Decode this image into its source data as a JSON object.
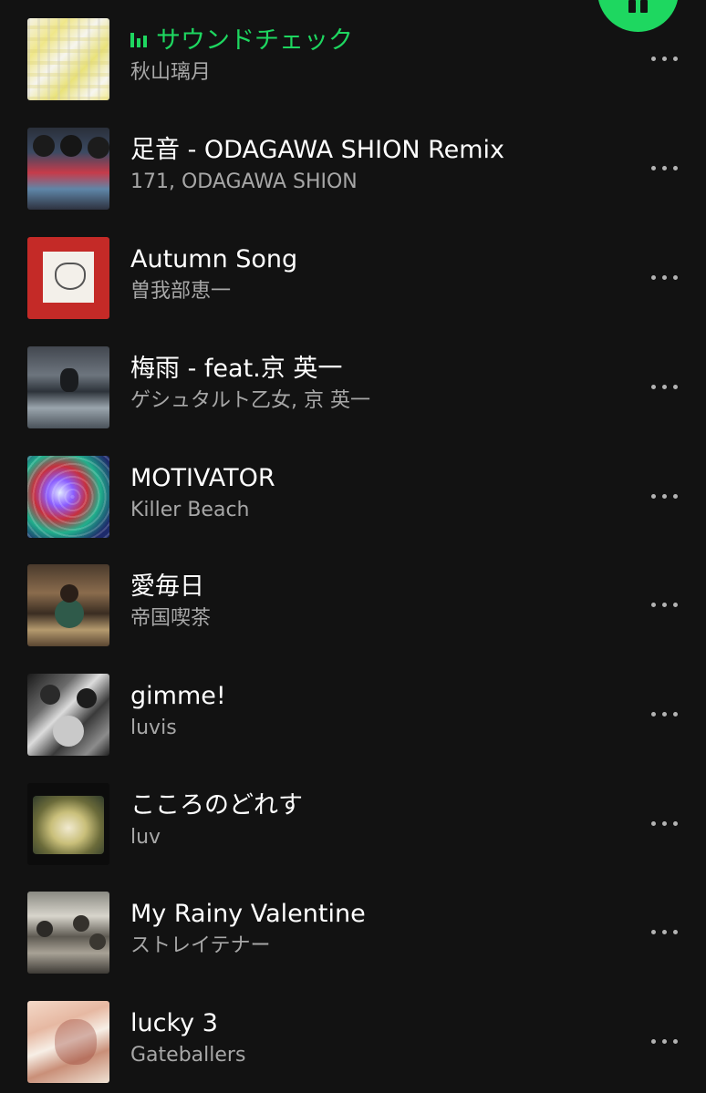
{
  "now_playing_button": {
    "icon": "pause-icon",
    "color": "#1ed760"
  },
  "tracks": [
    {
      "title": "サウンドチェック",
      "artist": "秋山璃月",
      "playing": true
    },
    {
      "title": "足音 - ODAGAWA SHION Remix",
      "artist": "171, ODAGAWA SHION",
      "playing": false
    },
    {
      "title": "Autumn Song",
      "artist": "曽我部恵一",
      "playing": false
    },
    {
      "title": "梅雨 - feat.京 英一",
      "artist": "ゲシュタルト乙女, 京 英一",
      "playing": false
    },
    {
      "title": "MOTIVATOR",
      "artist": "Killer Beach",
      "playing": false
    },
    {
      "title": "愛毎日",
      "artist": "帝国喫茶",
      "playing": false
    },
    {
      "title": "gimme!",
      "artist": "luvis",
      "playing": false
    },
    {
      "title": "こころのどれす",
      "artist": "luv",
      "playing": false
    },
    {
      "title": "My Rainy Valentine",
      "artist": "ストレイテナー",
      "playing": false
    },
    {
      "title": "lucky 3",
      "artist": "Gateballers",
      "playing": false
    }
  ],
  "row_more_icon": "more-horizontal-icon",
  "colors": {
    "background": "#121212",
    "accent": "#1ed760",
    "title": "#ffffff",
    "subtitle": "#a7a7a7"
  }
}
